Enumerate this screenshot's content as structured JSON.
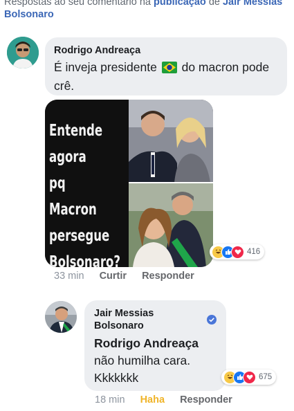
{
  "header": {
    "prefix": "Respostas ao seu comentário na",
    "link1": "publicação",
    "mid": "de",
    "link2": "Jair Messias Bolsonaro"
  },
  "comment1": {
    "author": "Rodrigo Andreaça",
    "text_before_flag": "É inveja presidente",
    "text_after_flag": "do macron pode crê.",
    "flag_icon": "brazil-flag-icon",
    "image_text": [
      "Entende",
      "agora",
      "pq Macron",
      "persegue",
      "Bolsonaro?"
    ],
    "reaction_count": "416",
    "time": "33 min",
    "like_label": "Curtir",
    "reply_label": "Responder"
  },
  "comment2": {
    "author_line1": "Jair Messias",
    "author_line2": "Bolsonaro",
    "verified_icon": "verified-badge-icon",
    "mention": "Rodrigo Andreaça",
    "text_line1": "não humilha cara.",
    "text_line2": "Kkkkkkk",
    "reaction_count": "675",
    "time": "18 min",
    "reaction_label": "Haha",
    "reply_label": "Responder"
  },
  "colors": {
    "link": "#3b67b6",
    "bubble": "#eceef1",
    "haha": "#f0b429",
    "like": "#1877f2",
    "love": "#f0284a",
    "verified": "#4a76d8"
  }
}
